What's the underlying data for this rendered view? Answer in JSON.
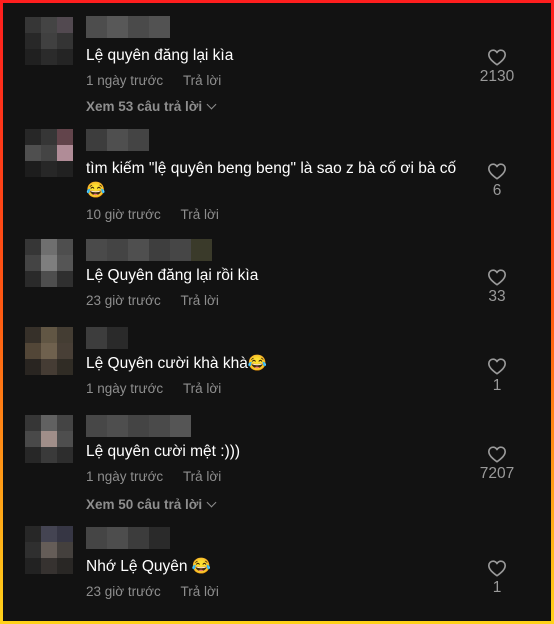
{
  "comments": [
    {
      "text": "Lệ quyên đăng lại kìa",
      "time": "1 ngày trước",
      "reply": "Trả lời",
      "likes": "2130",
      "more": "Xem 53 câu trả lời"
    },
    {
      "text": "tìm kiếm \"lệ quyên beng beng\" là sao z bà cố ơi bà cố 😂",
      "time": "10 giờ trước",
      "reply": "Trả lời",
      "likes": "6"
    },
    {
      "text": "Lệ Quyên đăng lại rồi kìa",
      "time": "23 giờ trước",
      "reply": "Trả lời",
      "likes": "33"
    },
    {
      "text": "Lệ Quyên cười khà khà😂",
      "time": "1 ngày trước",
      "reply": "Trả lời",
      "likes": "1"
    },
    {
      "text": "Lệ quyên cười mệt :)))",
      "time": "1 ngày trước",
      "reply": "Trả lời",
      "likes": "7207",
      "more": "Xem 50 câu trả lời"
    },
    {
      "text": "Nhớ Lệ Quyên 😂",
      "time": "23 giờ trước",
      "reply": "Trả lời",
      "likes": "1"
    }
  ],
  "colors": {
    "background": "#121212",
    "text": "#ffffff",
    "muted": "#8e8e8e",
    "border_gradient": [
      "#ff1e1e",
      "#ffd21a"
    ]
  },
  "icons": {
    "like": "heart-outline-icon",
    "expand": "chevron-down-icon"
  }
}
